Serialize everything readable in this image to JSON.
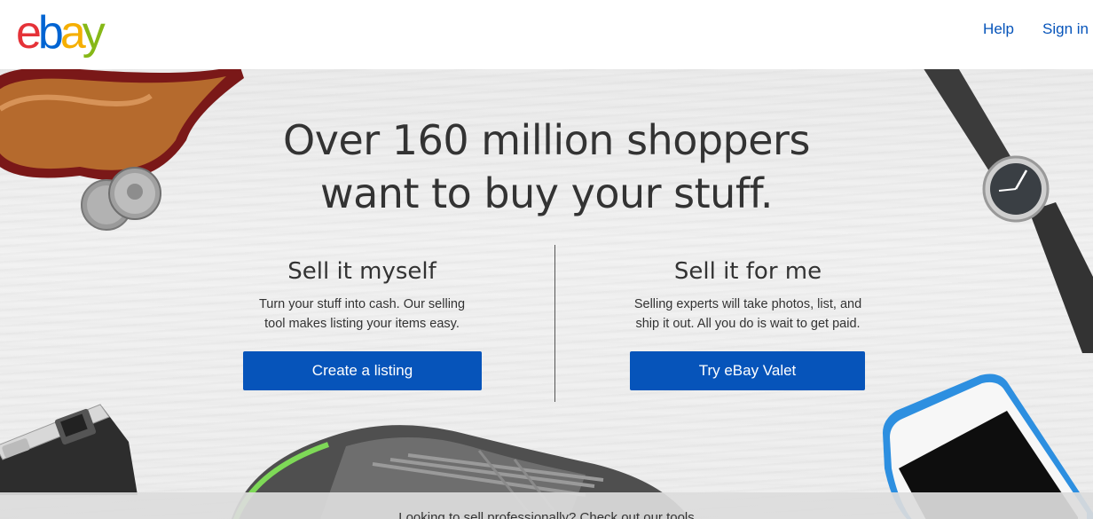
{
  "brand": {
    "logo_letters": [
      "e",
      "b",
      "a",
      "y"
    ],
    "logo_colors": [
      "#e53238",
      "#0064d2",
      "#f5af02",
      "#86b817"
    ]
  },
  "nav": {
    "help": "Help",
    "sign_in": "Sign in"
  },
  "hero": {
    "headline_line1": "Over 160 million shoppers",
    "headline_line2": "want to buy your stuff."
  },
  "sell_myself": {
    "title": "Sell it myself",
    "desc_line1": "Turn your stuff into cash. Our selling",
    "desc_line2": "tool makes listing your items easy.",
    "button": "Create a listing"
  },
  "sell_for_me": {
    "title": "Sell it for me",
    "desc_line1": "Selling experts will take photos, list, and",
    "desc_line2": "ship it out. All you do is wait to get paid.",
    "button": "Try eBay Valet"
  },
  "footer": {
    "text": "Looking to sell professionally? Check out our tools"
  },
  "colors": {
    "accent": "#0654ba",
    "text": "#333333"
  }
}
